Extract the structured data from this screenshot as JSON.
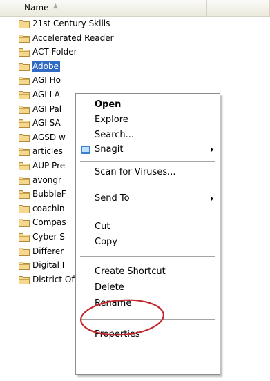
{
  "header": {
    "name_label": "Name"
  },
  "folders": [
    {
      "label": "21st Century Skills"
    },
    {
      "label": "Accelerated Reader"
    },
    {
      "label": "ACT Folder"
    },
    {
      "label": "Adobe"
    },
    {
      "label": "AGI Ho"
    },
    {
      "label": "AGI LA"
    },
    {
      "label": "AGI Pal"
    },
    {
      "label": "AGI SA"
    },
    {
      "label": "AGSD w"
    },
    {
      "label": "articles"
    },
    {
      "label": "AUP Pre"
    },
    {
      "label": "avongr"
    },
    {
      "label": "BubbleF"
    },
    {
      "label": "coachin"
    },
    {
      "label": "Compas"
    },
    {
      "label": "Cyber S"
    },
    {
      "label": "Differer"
    },
    {
      "label": "Digital I"
    },
    {
      "label": "District Office"
    }
  ],
  "selected_folder": "Adobe",
  "context_menu": {
    "open": "Open",
    "explore": "Explore",
    "search": "Search...",
    "snagit": "Snagit",
    "scan": "Scan for Viruses...",
    "send_to": "Send To",
    "cut": "Cut",
    "copy": "Copy",
    "create_shortcut": "Create Shortcut",
    "delete": "Delete",
    "rename": "Rename",
    "properties": "Properties"
  },
  "colors": {
    "selection": "#316ac5",
    "highlight_ellipse": "#c0282e",
    "folder_fill": "#f5d78d"
  }
}
